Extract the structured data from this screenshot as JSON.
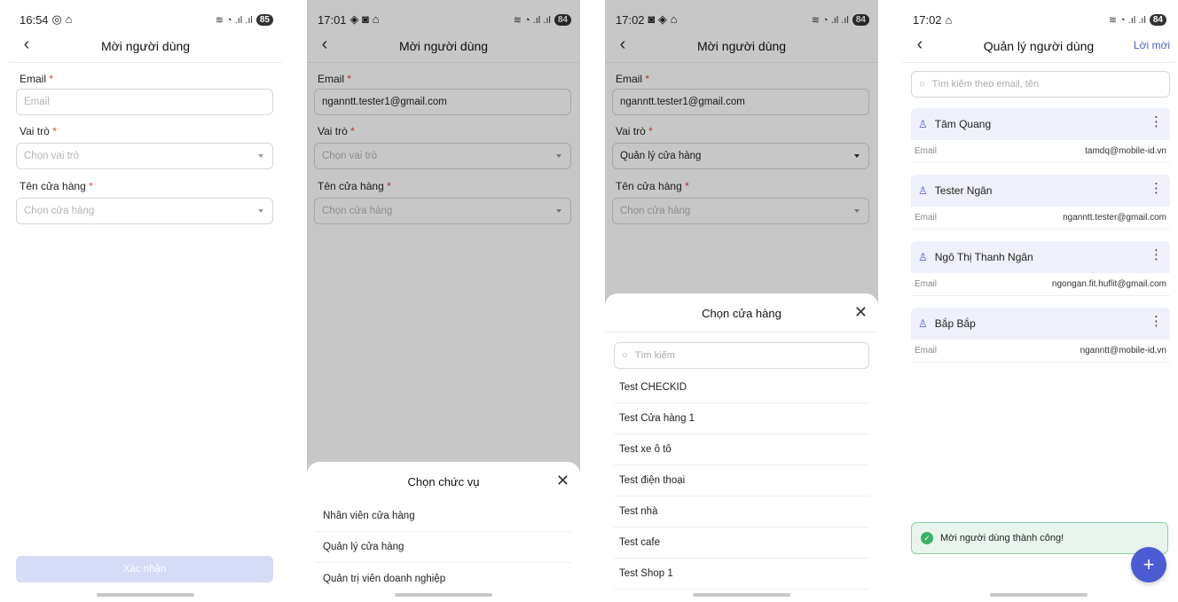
{
  "status_bars": [
    {
      "time": "16:54",
      "battery": "85"
    },
    {
      "time": "17:01",
      "battery": "84"
    },
    {
      "time": "17:02",
      "battery": "84"
    },
    {
      "time": "17:02",
      "battery": "84"
    }
  ],
  "invite_form": {
    "title": "Mời người dùng",
    "email_label": "Email",
    "required_mark": "*",
    "email_placeholder": "Email",
    "role_label": "Vai trò",
    "role_placeholder": "Chọn vai trò",
    "store_label": "Tên cửa hàng",
    "store_placeholder": "Chọn cửa hàng",
    "confirm_button": "Xác nhận"
  },
  "screen2": {
    "email_value": "nganntt.tester1@gmail.com",
    "sheet_title": "Chọn chức vụ",
    "options": [
      "Nhân viên cửa hàng",
      "Quản lý cửa hàng",
      "Quản trị viên doanh nghiệp"
    ]
  },
  "screen3": {
    "email_value": "nganntt.tester1@gmail.com",
    "role_value": "Quản lý cửa hàng",
    "sheet_title": "Chọn cửa hàng",
    "search_placeholder": "Tìm kiếm",
    "stores": [
      "Test CHECKID",
      "Test Cửa hàng 1",
      "Test  xe ô tô",
      "Test điện thoại",
      "Test nhà",
      "Test cafe",
      "Test Shop 1"
    ]
  },
  "user_mgmt": {
    "title": "Quản lý người dùng",
    "header_action": "Lời mời",
    "search_placeholder": "Tìm kiếm theo email, tên",
    "email_key": "Email",
    "users": [
      {
        "name": "Tâm Quang",
        "email": "tamdq@mobile-id.vn"
      },
      {
        "name": "Tester Ngân",
        "email": "nganntt.tester@gmail.com"
      },
      {
        "name": "Ngô Thị Thanh Ngân",
        "email": "ngongan.fit.huflit@gmail.com"
      },
      {
        "name": "Bắp Bắp",
        "email": "nganntt@mobile-id.vn"
      }
    ],
    "toast": "Mời người dùng thành công!",
    "fab": "+"
  },
  "colors": {
    "accent": "#4a5bd4",
    "required": "#e0453a",
    "success": "#3bb16a",
    "card_bg": "#eef0fb"
  },
  "icons": [
    "back-icon",
    "close-icon",
    "search-icon",
    "user-icon",
    "more-vertical-icon",
    "check-circle-icon",
    "plus-icon",
    "dropdown-caret-icon"
  ]
}
